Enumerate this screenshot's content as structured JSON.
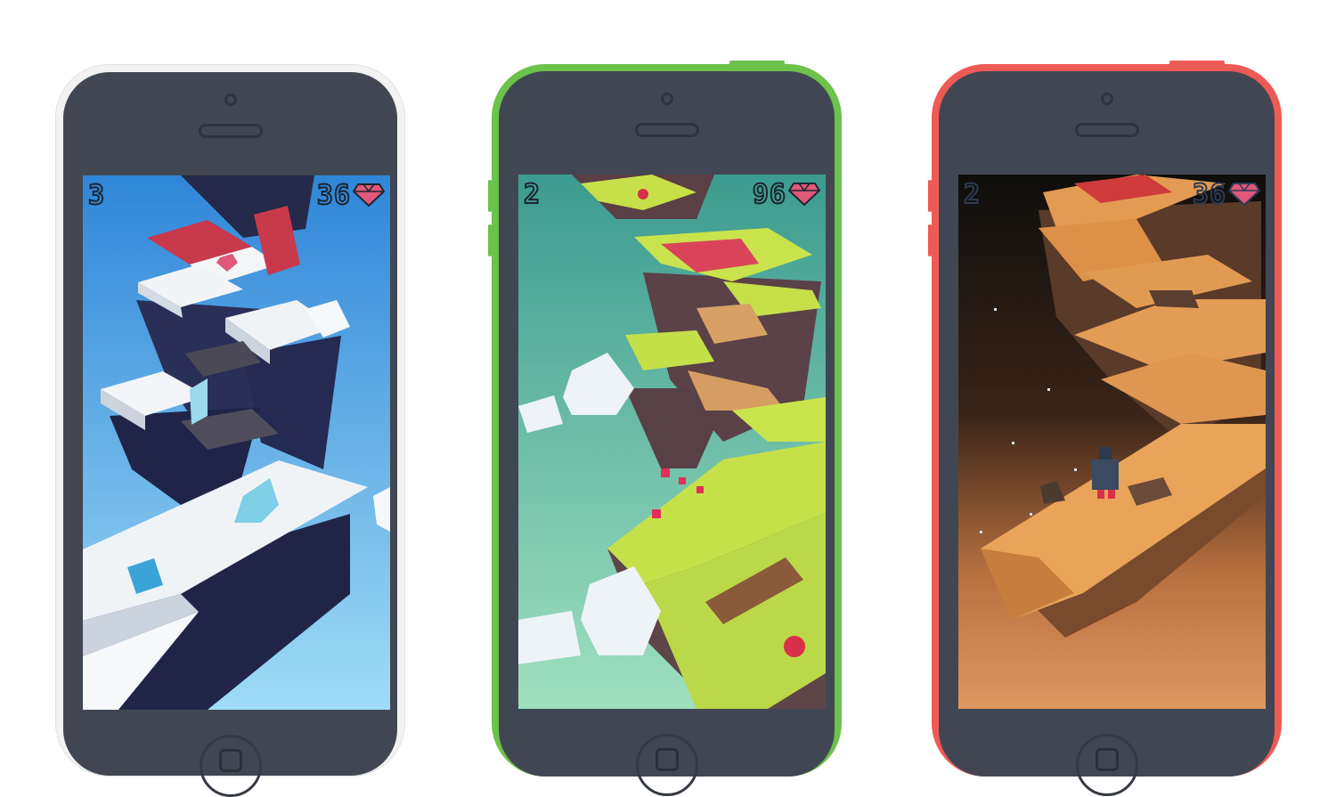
{
  "phones": [
    {
      "name": "white",
      "frame_color": "#f0f0f0",
      "theme": "snow-world",
      "hud": {
        "level": "3",
        "gems": "36"
      }
    },
    {
      "name": "green",
      "frame_color": "#6cc24a",
      "theme": "grass-world",
      "hud": {
        "level": "2",
        "gems": "96"
      }
    },
    {
      "name": "red",
      "frame_color": "#ee5a55",
      "theme": "desert-world",
      "hud": {
        "level": "2",
        "gems": "36"
      }
    }
  ],
  "colors": {
    "screen_body": "#414752",
    "gem": "#e0587a"
  },
  "icons": [
    "gem-icon",
    "camera-icon",
    "speaker-icon",
    "home-button-icon"
  ]
}
